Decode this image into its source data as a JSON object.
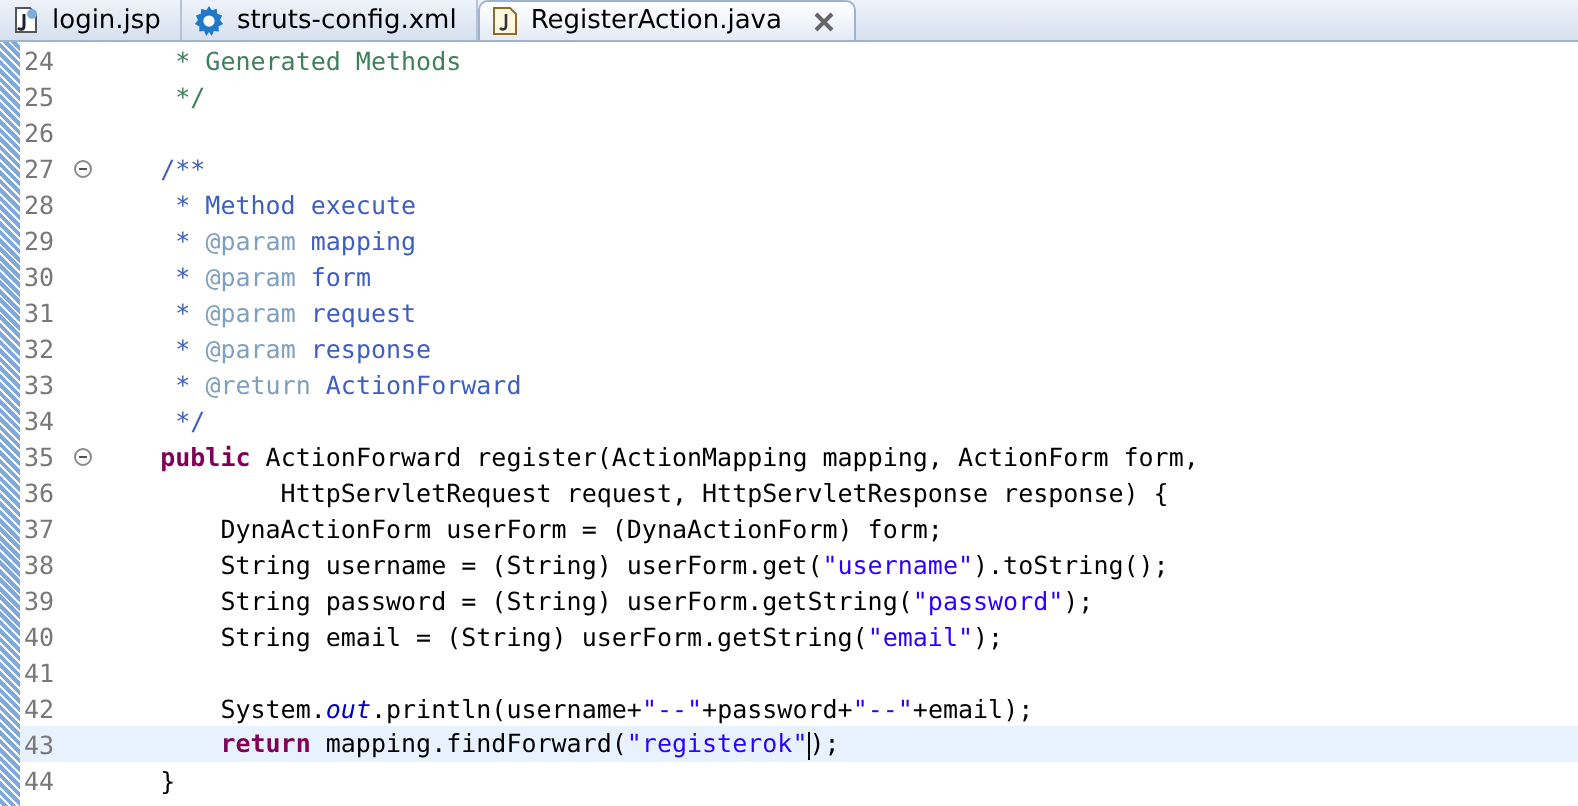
{
  "tabs": [
    {
      "label": "login.jsp",
      "kind": "jsp",
      "selected": false,
      "closable": false
    },
    {
      "label": "struts-config.xml",
      "kind": "xml",
      "selected": false,
      "closable": false
    },
    {
      "label": "RegisterAction.java",
      "kind": "java",
      "selected": true,
      "closable": true
    }
  ],
  "lines": [
    {
      "number": "24",
      "fold": false,
      "current": false,
      "tokens": [
        {
          "kind": "comment",
          "text": "     * Generated Methods"
        }
      ]
    },
    {
      "number": "25",
      "fold": false,
      "current": false,
      "tokens": [
        {
          "kind": "comment",
          "text": "     */"
        }
      ]
    },
    {
      "number": "26",
      "fold": false,
      "current": false
    },
    {
      "number": "27",
      "fold": true,
      "current": false,
      "tokens": [
        {
          "kind": "javadoc",
          "text": "    /**"
        }
      ]
    },
    {
      "number": "28",
      "fold": false,
      "current": false,
      "tokens": [
        {
          "kind": "javadoc",
          "text": "     * Method execute"
        }
      ]
    },
    {
      "number": "29",
      "fold": false,
      "current": false,
      "tokens": [
        {
          "kind": "javadoc",
          "text": "     * "
        },
        {
          "kind": "tag",
          "text": "@param"
        },
        {
          "kind": "javadoc",
          "text": " mapping"
        }
      ]
    },
    {
      "number": "30",
      "fold": false,
      "current": false,
      "tokens": [
        {
          "kind": "javadoc",
          "text": "     * "
        },
        {
          "kind": "tag",
          "text": "@param"
        },
        {
          "kind": "javadoc",
          "text": " form"
        }
      ]
    },
    {
      "number": "31",
      "fold": false,
      "current": false,
      "tokens": [
        {
          "kind": "javadoc",
          "text": "     * "
        },
        {
          "kind": "tag",
          "text": "@param"
        },
        {
          "kind": "javadoc",
          "text": " request"
        }
      ]
    },
    {
      "number": "32",
      "fold": false,
      "current": false,
      "tokens": [
        {
          "kind": "javadoc",
          "text": "     * "
        },
        {
          "kind": "tag",
          "text": "@param"
        },
        {
          "kind": "javadoc",
          "text": " response"
        }
      ]
    },
    {
      "number": "33",
      "fold": false,
      "current": false,
      "tokens": [
        {
          "kind": "javadoc",
          "text": "     * "
        },
        {
          "kind": "tag",
          "text": "@return"
        },
        {
          "kind": "javadoc",
          "text": " ActionForward"
        }
      ]
    },
    {
      "number": "34",
      "fold": false,
      "current": false,
      "tokens": [
        {
          "kind": "javadoc",
          "text": "     */"
        }
      ]
    },
    {
      "number": "35",
      "fold": true,
      "current": false,
      "tokens": [
        {
          "kind": "keyword",
          "text": "    public"
        },
        {
          "kind": "plain",
          "text": " ActionForward register(ActionMapping mapping, ActionForm form,"
        }
      ]
    },
    {
      "number": "36",
      "fold": false,
      "current": false,
      "tokens": [
        {
          "kind": "plain",
          "text": "            HttpServletRequest request, HttpServletResponse response) {"
        }
      ]
    },
    {
      "number": "37",
      "fold": false,
      "current": false,
      "tokens": [
        {
          "kind": "plain",
          "text": "        DynaActionForm userForm = (DynaActionForm) form;"
        }
      ]
    },
    {
      "number": "38",
      "fold": false,
      "current": false,
      "tokens": [
        {
          "kind": "plain",
          "text": "        String username = (String) userForm.get("
        },
        {
          "kind": "string",
          "text": "\"username\""
        },
        {
          "kind": "plain",
          "text": ").toString();"
        }
      ]
    },
    {
      "number": "39",
      "fold": false,
      "current": false,
      "tokens": [
        {
          "kind": "plain",
          "text": "        String password = (String) userForm.getString("
        },
        {
          "kind": "string",
          "text": "\"password\""
        },
        {
          "kind": "plain",
          "text": ");"
        }
      ]
    },
    {
      "number": "40",
      "fold": false,
      "current": false,
      "tokens": [
        {
          "kind": "plain",
          "text": "        String email = (String) userForm.getString("
        },
        {
          "kind": "string",
          "text": "\"email\""
        },
        {
          "kind": "plain",
          "text": ");"
        }
      ]
    },
    {
      "number": "41",
      "fold": false,
      "current": false
    },
    {
      "number": "42",
      "fold": false,
      "current": false,
      "tokens": [
        {
          "kind": "plain",
          "text": "        System."
        },
        {
          "kind": "field",
          "text": "out"
        },
        {
          "kind": "plain",
          "text": ".println(username+"
        },
        {
          "kind": "string",
          "text": "\"--\""
        },
        {
          "kind": "plain",
          "text": "+password+"
        },
        {
          "kind": "string",
          "text": "\"--\""
        },
        {
          "kind": "plain",
          "text": "+email);"
        }
      ]
    },
    {
      "number": "43",
      "fold": false,
      "current": true,
      "tokens": [
        {
          "kind": "keyword",
          "text": "        return"
        },
        {
          "kind": "plain",
          "text": " mapping.findForward("
        },
        {
          "kind": "string",
          "text": "\"registerok\"",
          "caret": true
        },
        {
          "kind": "plain",
          "text": ");"
        }
      ]
    },
    {
      "number": "44",
      "fold": false,
      "current": false,
      "tokens": [
        {
          "kind": "plain",
          "text": "    }"
        }
      ]
    }
  ]
}
